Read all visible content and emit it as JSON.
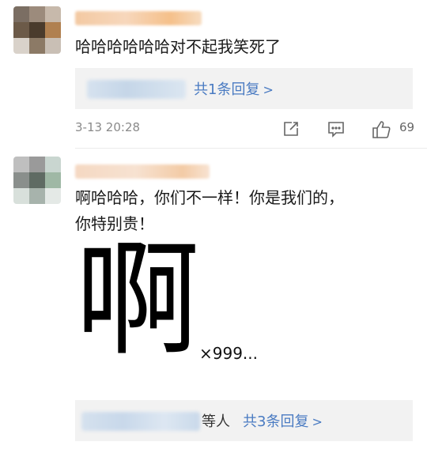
{
  "comments": [
    {
      "text": "哈哈哈哈哈哈对不起我笑死了",
      "reply_link": "共1条回复",
      "timestamp": "3-13 20:28",
      "likes": "69",
      "icons": [
        "share-icon",
        "comment-icon",
        "like-icon"
      ]
    },
    {
      "text_line1": "啊哈哈哈，你们不一样！你是我们的，",
      "text_line2": "你特别贵！",
      "big_char": "啊",
      "multiplier": "×999...",
      "reply_others": "等人",
      "reply_link": "共3条回复"
    }
  ],
  "colors": {
    "link": "#4a7bc2",
    "reply_bg": "#f2f2f2",
    "meta": "#8a8a8a"
  }
}
